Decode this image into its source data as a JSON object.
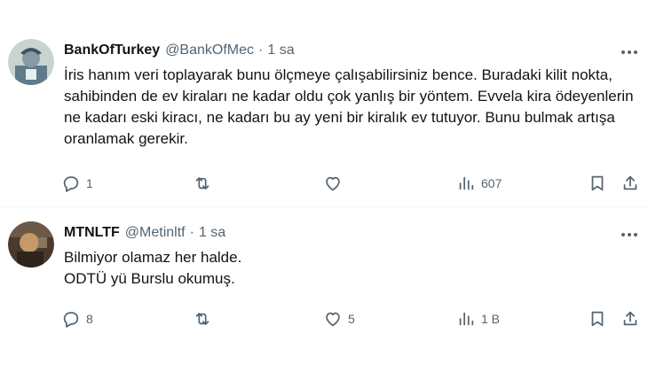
{
  "tweets": [
    {
      "name": "BankOfTurkey",
      "handle": "@BankOfMec",
      "separator": "·",
      "time": "1 sa",
      "text": "İris hanım veri toplayarak bunu ölçmeye çalışabilirsiniz bence. Buradaki kilit nokta, sahibinden de ev kiraları ne kadar oldu çok yanlış bir yöntem. Evvela kira ödeyenlerin ne kadarı eski kiracı, ne kadarı bu ay yeni bir kiralık ev tutuyor. Bunu bulmak artışa oranlamak gerekir.",
      "avatar_colors": {
        "bg": "#c9d4d0",
        "accent": "#5f7a8a"
      },
      "actions": {
        "replies": "1",
        "retweets": "",
        "likes": "",
        "views": "607"
      }
    },
    {
      "name": "MTNLTF",
      "handle": "@Metinltf",
      "separator": "·",
      "time": "1 sa",
      "text": "Bilmiyor olamaz her halde.\nODTÜ yü Burslu okumuş.",
      "avatar_colors": {
        "bg": "#4a3a2e",
        "accent": "#c59a6a"
      },
      "actions": {
        "replies": "8",
        "retweets": "",
        "likes": "5",
        "views": "1 B"
      }
    }
  ],
  "icons": {
    "reply": "reply-icon",
    "retweet": "retweet-icon",
    "like": "heart-icon",
    "views": "views-icon",
    "bookmark": "bookmark-icon",
    "share": "share-icon",
    "more": "more-icon"
  },
  "colors": {
    "text": "#0f1419",
    "muted": "#536471",
    "divider": "#eff3f4"
  }
}
